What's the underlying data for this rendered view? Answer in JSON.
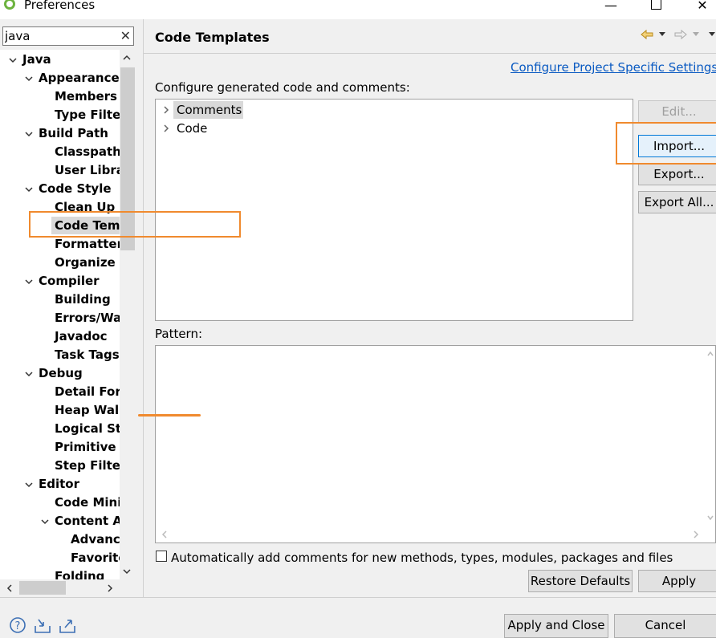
{
  "window": {
    "title": "Preferences"
  },
  "filter": {
    "value": "java"
  },
  "tree": {
    "items": [
      {
        "label": "Java"
      },
      {
        "label": "Appearance"
      },
      {
        "label": "Members S"
      },
      {
        "label": "Type Filters"
      },
      {
        "label": "Build Path"
      },
      {
        "label": "Classpath V"
      },
      {
        "label": "User Librar"
      },
      {
        "label": "Code Style"
      },
      {
        "label": "Clean Up"
      },
      {
        "label": "Code Temp"
      },
      {
        "label": "Formatter"
      },
      {
        "label": "Organize In"
      },
      {
        "label": "Compiler"
      },
      {
        "label": "Building"
      },
      {
        "label": "Errors/War"
      },
      {
        "label": "Javadoc"
      },
      {
        "label": "Task Tags"
      },
      {
        "label": "Debug"
      },
      {
        "label": "Detail Form"
      },
      {
        "label": "Heap Walk"
      },
      {
        "label": "Logical Stru"
      },
      {
        "label": "Primitive D"
      },
      {
        "label": "Step Filteri"
      },
      {
        "label": "Editor"
      },
      {
        "label": "Code Minin"
      },
      {
        "label": "Content As"
      },
      {
        "label": "Advanc"
      },
      {
        "label": "Favorite"
      },
      {
        "label": "Folding"
      }
    ]
  },
  "page": {
    "title": "Code Templates",
    "link": "Configure Project Specific Settings...",
    "configure_label": "Configure generated code and comments:",
    "templates": [
      {
        "label": "Comments"
      },
      {
        "label": "Code"
      }
    ],
    "buttons": {
      "edit": "Edit...",
      "import": "Import...",
      "export": "Export...",
      "export_all": "Export All..."
    },
    "pattern_label": "Pattern:",
    "auto_comment_label": "Automatically add comments for new methods, types, modules, packages and files",
    "auto_comment_checked": false,
    "restore_defaults": "Restore Defaults",
    "apply": "Apply"
  },
  "footer": {
    "apply_close": "Apply and Close",
    "cancel": "Cancel"
  },
  "colors": {
    "highlight": "#f08a2e",
    "link": "#0a5ac2",
    "selection": "#d9d9d9"
  }
}
